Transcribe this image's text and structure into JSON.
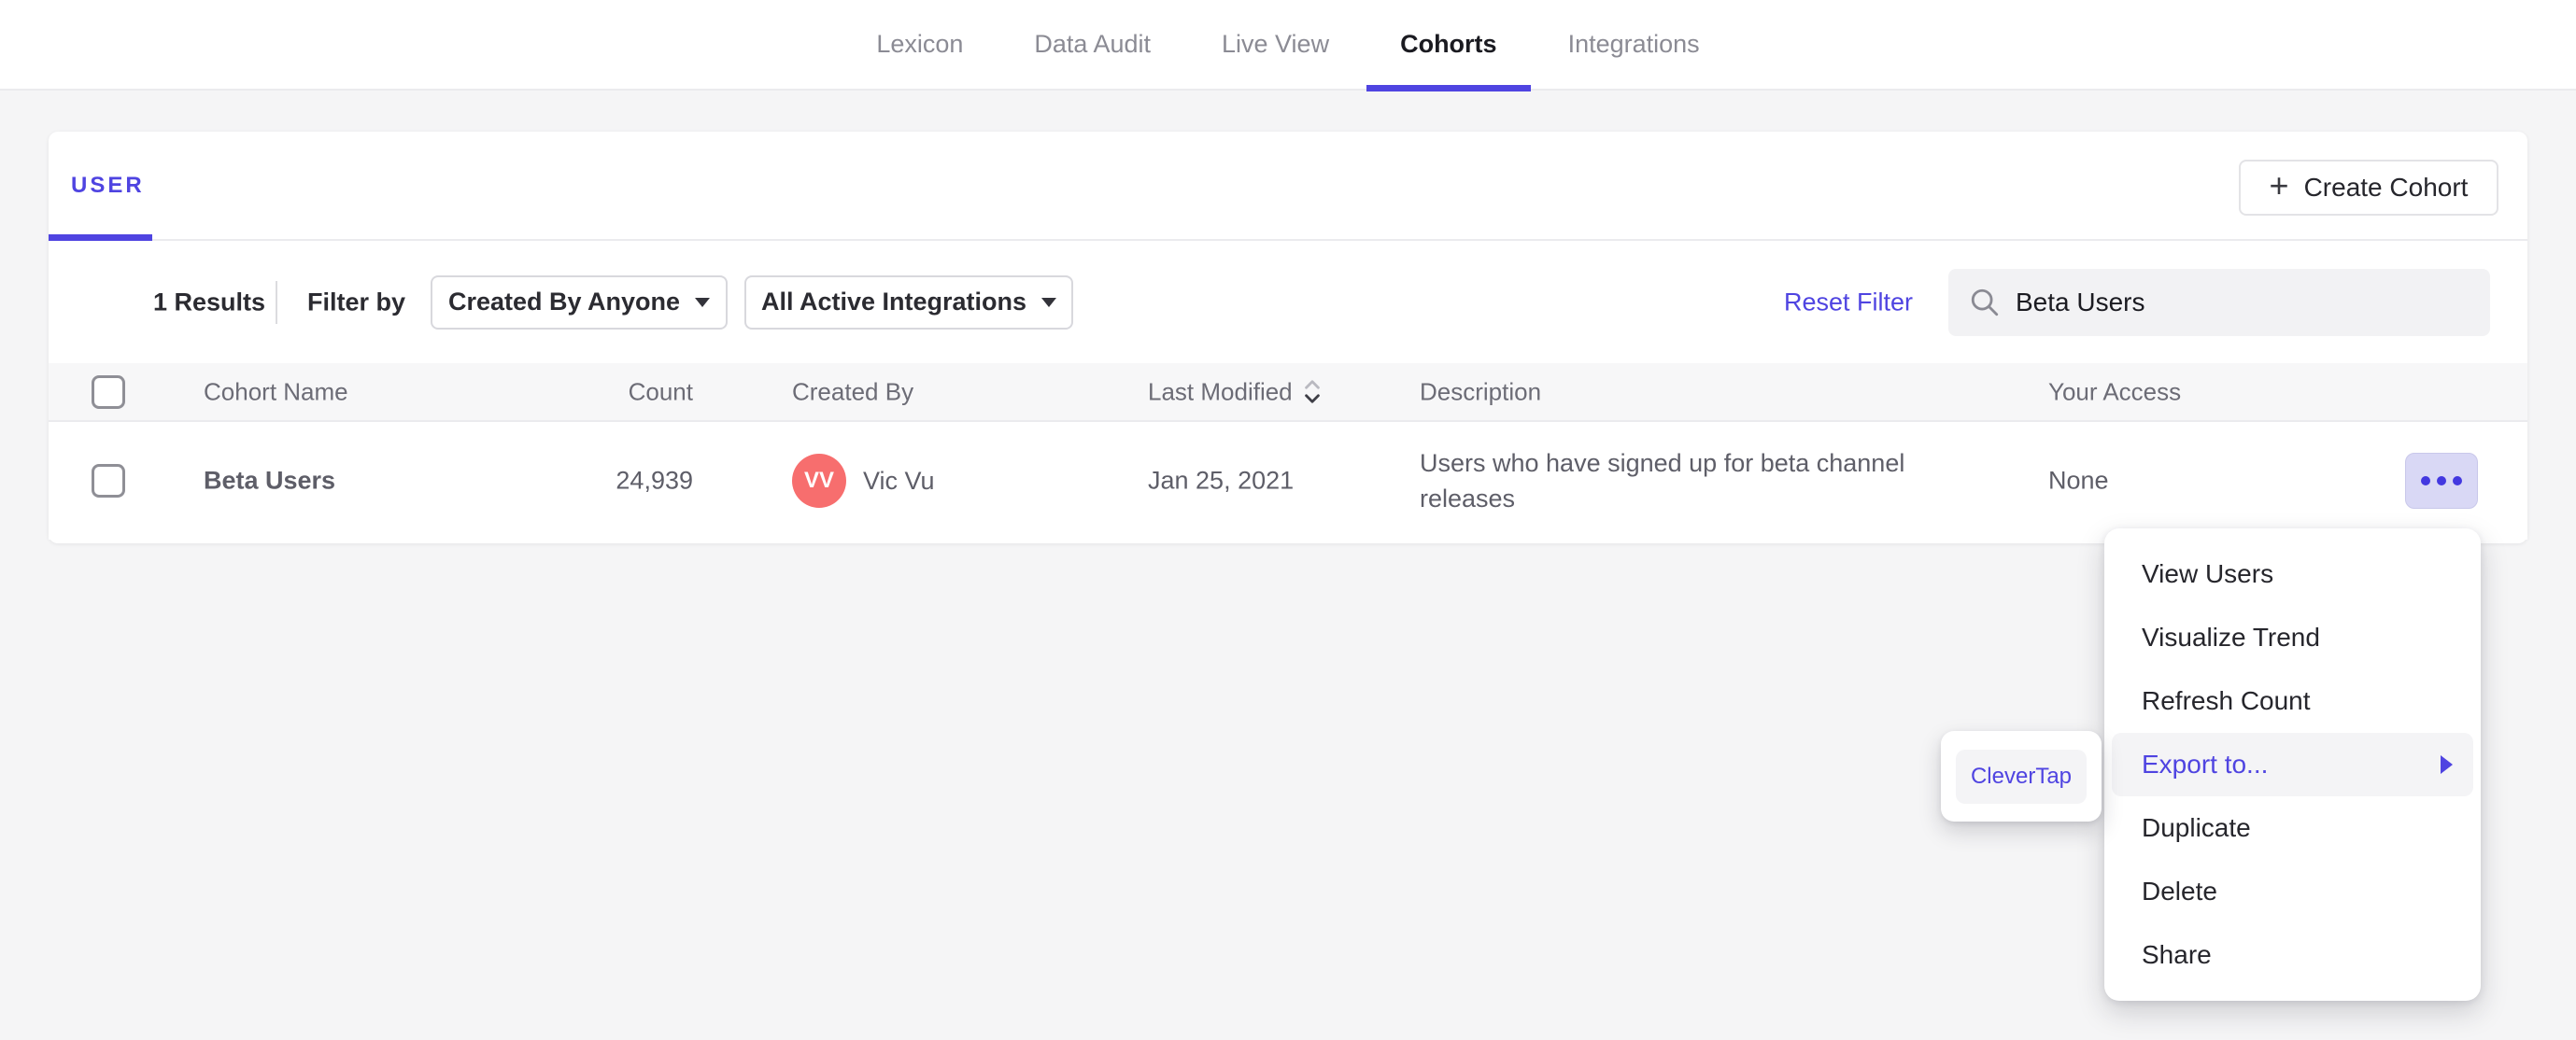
{
  "colors": {
    "accent": "#4f44e1",
    "avatar": "#f76e6e",
    "page_background": "#f5f5f6",
    "menu_highlight": "#f4f4f6"
  },
  "nav": {
    "active": "Cohorts",
    "items": [
      {
        "label": "Lexicon"
      },
      {
        "label": "Data Audit"
      },
      {
        "label": "Live View"
      },
      {
        "label": "Cohorts"
      },
      {
        "label": "Integrations"
      }
    ]
  },
  "panel": {
    "active_tab": "USER",
    "create_button_plus": "+",
    "create_button_label": "Create Cohort",
    "filter_bar": {
      "results_count": "1 Results",
      "filter_by_label": "Filter by",
      "created_by_filter": "Created By Anyone",
      "integrations_filter": "All Active Integrations",
      "reset_filter_label": "Reset Filter",
      "search_value": "Beta Users"
    },
    "table": {
      "headers": {
        "name": "Cohort Name",
        "count": "Count",
        "created_by": "Created By",
        "last_modified": "Last Modified",
        "description": "Description",
        "access": "Your Access"
      },
      "rows": [
        {
          "name": "Beta Users",
          "count": "24,939",
          "creator_initials": "VV",
          "creator_name": "Vic Vu",
          "last_modified": "Jan 25, 2021",
          "description": "Users who have signed up for beta channel releases",
          "access": "None"
        }
      ]
    }
  },
  "context_menu": {
    "highlighted_item": "Export to...",
    "items": [
      {
        "label": "View Users"
      },
      {
        "label": "Visualize Trend"
      },
      {
        "label": "Refresh Count"
      },
      {
        "label": "Export to..."
      },
      {
        "label": "Duplicate"
      },
      {
        "label": "Delete"
      },
      {
        "label": "Share"
      }
    ]
  },
  "export_submenu": {
    "items": [
      {
        "label": "CleverTap"
      }
    ]
  }
}
